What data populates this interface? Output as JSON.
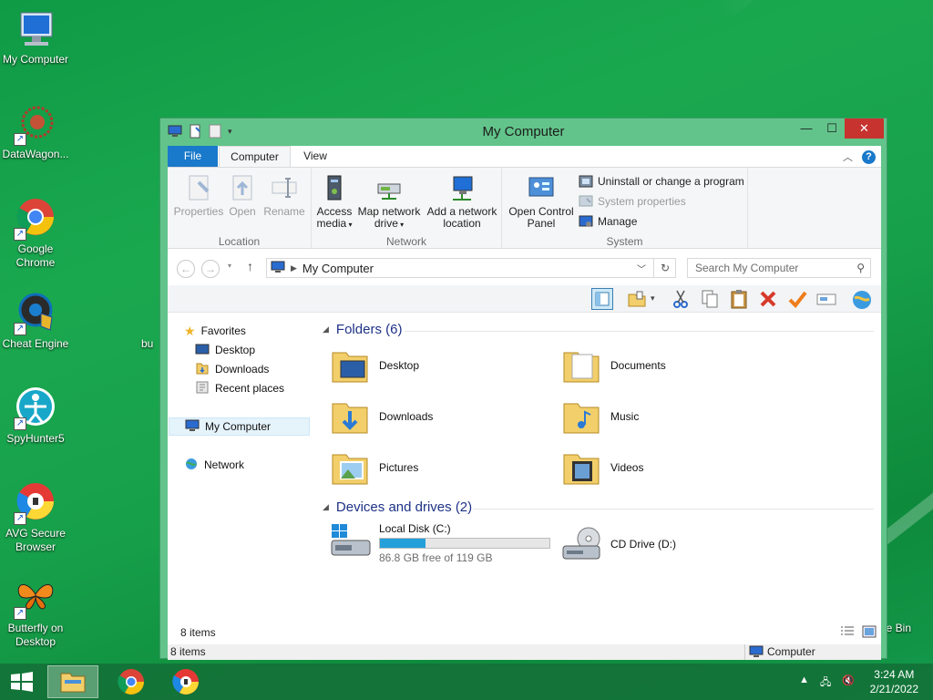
{
  "desktop": {
    "icons": [
      {
        "label": "My Computer",
        "icon": "computer-icon"
      },
      {
        "label": "DataWagon...",
        "icon": "datawagon-icon"
      },
      {
        "label": "Google Chrome",
        "icon": "chrome-icon"
      },
      {
        "label": "Cheat Engine",
        "icon": "cheat-engine-icon"
      },
      {
        "label": "SpyHunter5",
        "icon": "spyhunter-icon"
      },
      {
        "label": "AVG Secure Browser",
        "icon": "avg-browser-icon"
      },
      {
        "label": "Butterfly on Desktop",
        "icon": "butterfly-icon"
      }
    ],
    "partial_label_left": "bu",
    "partial_label_right": "le Bin"
  },
  "window": {
    "title": "My Computer",
    "tabs": {
      "file": "File",
      "computer": "Computer",
      "view": "View"
    },
    "ribbon": {
      "location": {
        "label": "Location",
        "properties": "Properties",
        "open": "Open",
        "rename": "Rename"
      },
      "network": {
        "label": "Network",
        "access_media_1": "Access",
        "access_media_2": "media",
        "map_drive_1": "Map network",
        "map_drive_2": "drive",
        "add_location_1": "Add a network",
        "add_location_2": "location"
      },
      "system": {
        "label": "System",
        "open_cp_1": "Open Control",
        "open_cp_2": "Panel",
        "uninstall": "Uninstall or change a program",
        "sys_props": "System properties",
        "manage": "Manage"
      }
    },
    "address": {
      "path": "My Computer",
      "search_placeholder": "Search My Computer"
    },
    "nav": {
      "favorites": "Favorites",
      "desktop": "Desktop",
      "downloads": "Downloads",
      "recent": "Recent places",
      "my_computer": "My Computer",
      "network": "Network"
    },
    "folders_header": "Folders (6)",
    "folders": [
      "Desktop",
      "Documents",
      "Downloads",
      "Music",
      "Pictures",
      "Videos"
    ],
    "devices_header": "Devices and drives (2)",
    "drives": {
      "c_name": "Local Disk (C:)",
      "c_free": "86.8 GB free of 119 GB",
      "c_used_fraction": 0.27,
      "d_name": "CD Drive (D:)"
    },
    "status_inner": "8 items",
    "status_outer": "8 items",
    "status_location": "Computer"
  },
  "taskbar": {
    "time": "3:24 AM",
    "date": "2/21/2022"
  },
  "colors": {
    "accent": "#1979ca",
    "desktop": "#13994a",
    "window_border": "#62c48a"
  }
}
